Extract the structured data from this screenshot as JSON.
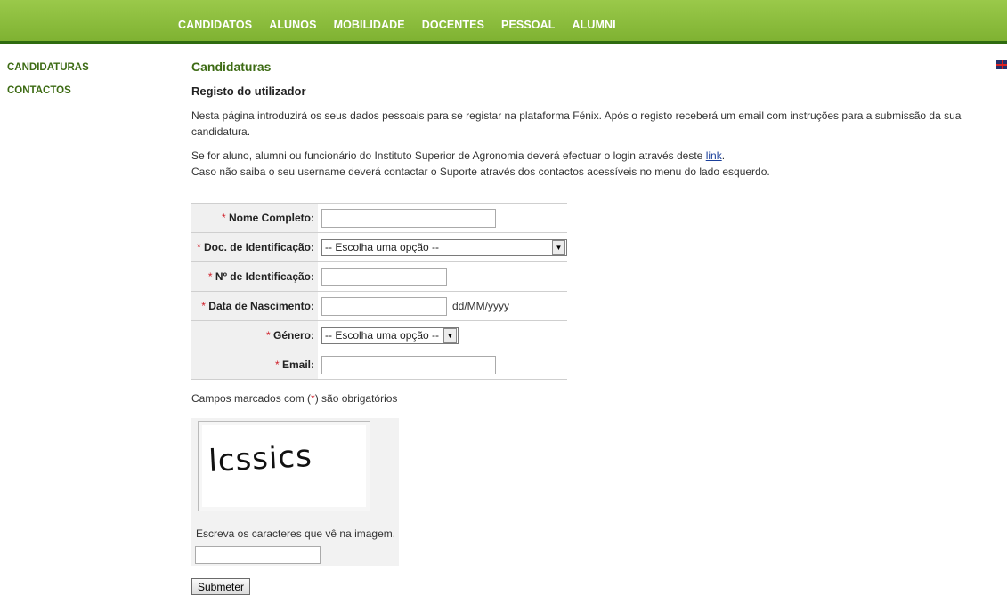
{
  "topnav": [
    "CANDIDATOS",
    "ALUNOS",
    "MOBILIDADE",
    "DOCENTES",
    "PESSOAL",
    "ALUMNI"
  ],
  "sidebar": [
    "CANDIDATURAS",
    "CONTACTOS"
  ],
  "page": {
    "title": "Candidaturas",
    "subtitle": "Registo do utilizador",
    "intro": "Nesta página introduzirá os seus dados pessoais para se registar na plataforma Fénix. Após o registo receberá um email com instruções para a submissão da sua candidatura.",
    "login_prefix": "Se for aluno, alumni ou funcionário do Instituto Superior de Agronomia deverá efectuar o login através deste ",
    "login_link": "link",
    "login_suffix": ".",
    "support": "Caso não saiba o seu username deverá contactar o Suporte através dos contactos acessíveis no menu do lado esquerdo."
  },
  "form": {
    "required_mark": "*",
    "fields": {
      "nome": {
        "label": "Nome Completo:",
        "value": ""
      },
      "doc": {
        "label": "Doc. de Identificação:",
        "selected": "-- Escolha uma opção --"
      },
      "num": {
        "label": "Nº de Identificação:",
        "value": ""
      },
      "data": {
        "label": "Data de Nascimento:",
        "value": "",
        "hint": "dd/MM/yyyy"
      },
      "genero": {
        "label": "Género:",
        "selected": "-- Escolha uma opção --"
      },
      "email": {
        "label": "Email:",
        "value": ""
      }
    },
    "note_prefix": "Campos marcados com (",
    "note_mark": "*",
    "note_suffix": ") são obrigatórios",
    "captcha_text": "lcssics",
    "captcha_hint": "Escreva os caracteres que vê na imagem.",
    "captcha_value": "",
    "submit": "Submeter"
  },
  "colors": {
    "nav_green": "#8cbd3e",
    "dark_green": "#2e6b10",
    "title_green": "#3d6b14",
    "required_red": "#d0202a",
    "link_blue": "#1a3f9a"
  }
}
